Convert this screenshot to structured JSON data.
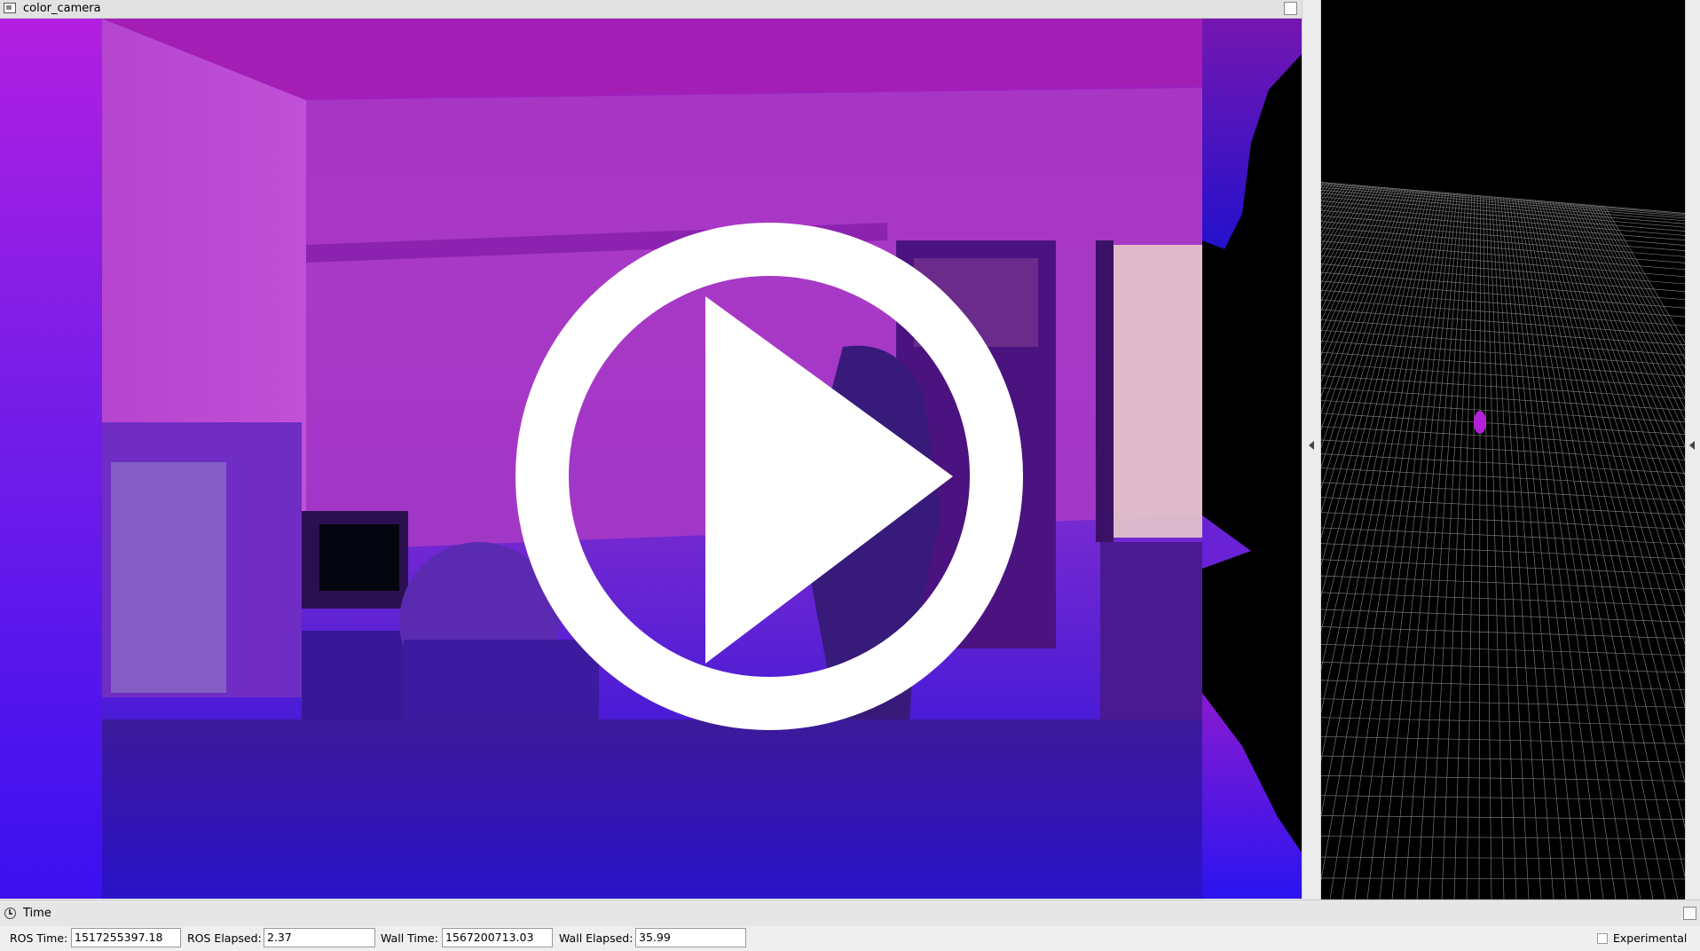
{
  "camera_panel": {
    "title": "color_camera"
  },
  "video_overlay": {
    "icon": "play-icon"
  },
  "time_panel": {
    "title": "Time",
    "ros_time_label": "ROS Time:",
    "ros_time_value": "1517255397.18",
    "ros_elapsed_label": "ROS Elapsed:",
    "ros_elapsed_value": "2.37",
    "wall_time_label": "Wall Time:",
    "wall_time_value": "1567200713.03",
    "wall_elapsed_label": "Wall Elapsed:",
    "wall_elapsed_value": "35.99",
    "experimental_label": "Experimental",
    "experimental_checked": false
  },
  "colors": {
    "overlay": "#ffffff",
    "grid_line": "#9a9a9a",
    "render_background": "#000000",
    "point_cloud_top": "#b21fd8",
    "point_cloud_bottom": "#3a10ef"
  }
}
